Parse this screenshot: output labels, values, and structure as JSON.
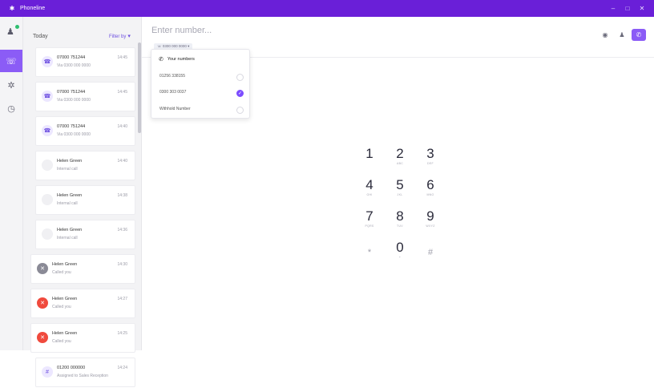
{
  "titlebar": {
    "app_name": "Phoneline",
    "logo": "app-logo",
    "controls": [
      "–",
      "□",
      "✕"
    ]
  },
  "rail": {
    "avatar_icon": "user-icon",
    "status_color": "#2fbf71",
    "items": [
      {
        "name": "calls-icon",
        "glyph": "☏"
      },
      {
        "name": "settings-icon",
        "glyph": "✲"
      },
      {
        "name": "history-icon",
        "glyph": "◷"
      }
    ]
  },
  "sidebar": {
    "section": "Today",
    "filter_label": "Filter by",
    "calls": [
      {
        "name": "07000 751244",
        "sub": "Via 0300 000 0000",
        "time": "14:45",
        "icon": "phone-icon",
        "icon_type": "phone"
      },
      {
        "name": "07000 751244",
        "sub": "Via 0300 000 0000",
        "time": "14:45",
        "icon": "phone-icon",
        "icon_type": "phone"
      },
      {
        "name": "07000 751244",
        "sub": "Via 0300 000 0000",
        "time": "14:40",
        "icon": "phone-icon",
        "icon_type": "phone"
      },
      {
        "name": "Helen Green",
        "sub": "Internal call",
        "time": "14:40",
        "icon": "internal-icon",
        "icon_type": "none"
      },
      {
        "name": "Helen Green",
        "sub": "Internal call",
        "time": "14:38",
        "icon": "internal-icon",
        "icon_type": "none"
      },
      {
        "name": "Helen Green",
        "sub": "Internal call",
        "time": "14:36",
        "icon": "internal-icon",
        "icon_type": "none"
      },
      {
        "name": "Helen Green",
        "sub": "Called you",
        "time": "14:30",
        "icon": "missed-call-icon",
        "icon_type": "grey"
      },
      {
        "name": "Helen Green",
        "sub": "Called you",
        "time": "14:27",
        "icon": "missed-call-icon",
        "icon_type": "red"
      },
      {
        "name": "Helen Green",
        "sub": "Called you",
        "time": "14:25",
        "icon": "missed-call-icon",
        "icon_type": "red"
      },
      {
        "name": "01200 000000",
        "sub": "Assigned to Sales Reception",
        "time": "14:24",
        "icon": "hash-icon",
        "icon_type": "lilac"
      }
    ]
  },
  "dialer": {
    "placeholder": "Enter number...",
    "caller_chip": "☏ 0300 000 0000  ▾",
    "actions": [
      {
        "name": "speaker-icon",
        "glyph": "🔈"
      },
      {
        "name": "contacts-icon",
        "glyph": "♟"
      },
      {
        "name": "call-button",
        "glyph": "☎"
      }
    ],
    "keys": [
      {
        "digit": "1",
        "letters": ""
      },
      {
        "digit": "2",
        "letters": "ABC"
      },
      {
        "digit": "3",
        "letters": "DEF"
      },
      {
        "digit": "4",
        "letters": "GHI"
      },
      {
        "digit": "5",
        "letters": "JKL"
      },
      {
        "digit": "6",
        "letters": "MNO"
      },
      {
        "digit": "7",
        "letters": "PQRS"
      },
      {
        "digit": "8",
        "letters": "TUV"
      },
      {
        "digit": "9",
        "letters": "WXYZ"
      },
      {
        "digit": "*",
        "letters": ""
      },
      {
        "digit": "0",
        "letters": "+"
      },
      {
        "digit": "#",
        "letters": ""
      }
    ]
  },
  "dropdown": {
    "title": "Your numbers",
    "options": [
      {
        "label": "01256 338155",
        "checked": false
      },
      {
        "label": "0300 303 0037",
        "checked": true
      },
      {
        "label": "Withhold Number",
        "checked": false
      }
    ],
    "check_glyph": "✓"
  },
  "colors": {
    "brand": "#6a1fd8",
    "accent": "#8b5cf6",
    "missed": "#f04a3d"
  }
}
